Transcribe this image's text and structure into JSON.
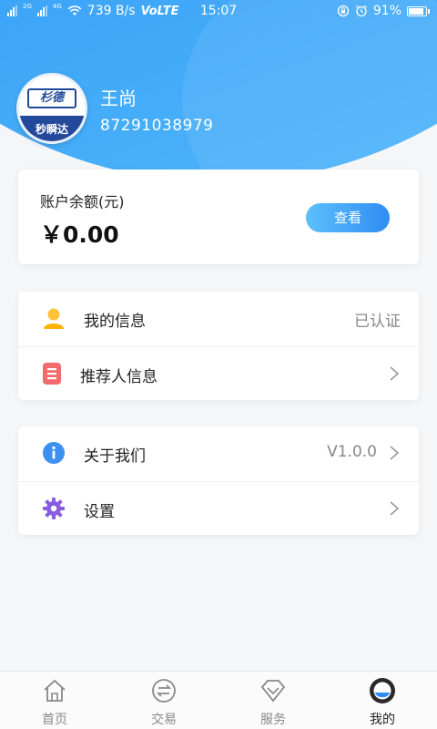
{
  "status_bar": {
    "network_1": "2G",
    "network_2": "4G",
    "speed": "739 B/s",
    "volte": "VoLTE",
    "time": "15:07",
    "battery": "91%"
  },
  "profile": {
    "name": "王尚",
    "phone": "87291038979",
    "avatar_top_text": "杉德",
    "avatar_bottom_text": "秒瞬达"
  },
  "balance": {
    "label": "账户余额(元)",
    "value": "￥0.00",
    "view_button": "查看"
  },
  "menu_group_1": [
    {
      "label": "我的信息",
      "value": "已认证",
      "icon": "user-icon"
    },
    {
      "label": "推荐人信息",
      "value": "",
      "icon": "document-icon"
    }
  ],
  "menu_group_2": [
    {
      "label": "关于我们",
      "value": "V1.0.0",
      "icon": "info-icon"
    },
    {
      "label": "设置",
      "value": "",
      "icon": "gear-icon"
    }
  ],
  "tabs": [
    {
      "label": "首页",
      "icon": "home-icon"
    },
    {
      "label": "交易",
      "icon": "transfer-icon"
    },
    {
      "label": "服务",
      "icon": "diamond-icon"
    },
    {
      "label": "我的",
      "icon": "profile-icon",
      "active": true
    }
  ],
  "colors": {
    "brand_blue": "#2f8df5",
    "button_gradient_start": "#5cc0fb",
    "button_gradient_end": "#2e8df4"
  }
}
